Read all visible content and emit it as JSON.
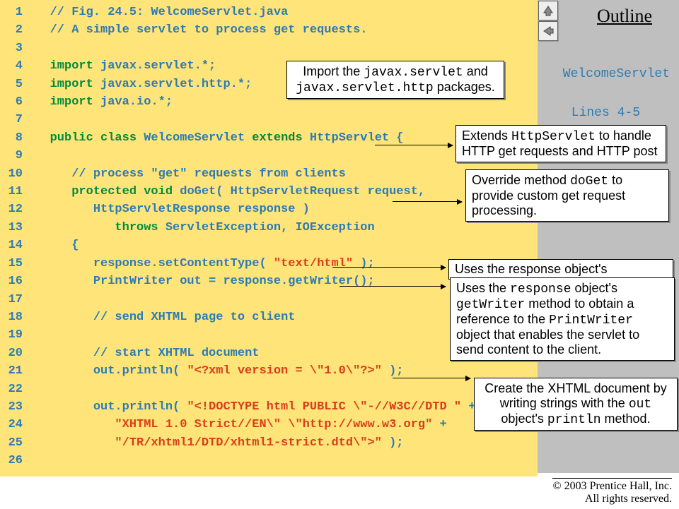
{
  "outline": "Outline",
  "side": {
    "name": "WelcomeServlet",
    "lines": "Lines 4-5"
  },
  "code": [
    {
      "n": "1",
      "segs": [
        {
          "t": "   ",
          "c": "co"
        },
        {
          "t": "// Fig. 24.5: WelcomeServlet.java",
          "c": "co"
        }
      ]
    },
    {
      "n": "2",
      "segs": [
        {
          "t": "   ",
          "c": "co"
        },
        {
          "t": "// A simple servlet to process get requests.",
          "c": "co"
        }
      ]
    },
    {
      "n": "3",
      "segs": [
        {
          "t": "",
          "c": "co"
        }
      ]
    },
    {
      "n": "4",
      "segs": [
        {
          "t": "   ",
          "c": "co"
        },
        {
          "t": "import",
          "c": "kw"
        },
        {
          "t": " javax.servlet.*;",
          "c": "tok"
        }
      ]
    },
    {
      "n": "5",
      "segs": [
        {
          "t": "   ",
          "c": "co"
        },
        {
          "t": "import",
          "c": "kw"
        },
        {
          "t": " javax.servlet.http.*;",
          "c": "tok"
        }
      ]
    },
    {
      "n": "6",
      "segs": [
        {
          "t": "   ",
          "c": "co"
        },
        {
          "t": "import",
          "c": "kw"
        },
        {
          "t": " java.io.*;",
          "c": "tok"
        }
      ]
    },
    {
      "n": "7",
      "segs": [
        {
          "t": "",
          "c": "co"
        }
      ]
    },
    {
      "n": "8",
      "segs": [
        {
          "t": "   ",
          "c": "co"
        },
        {
          "t": "public class",
          "c": "kw"
        },
        {
          "t": " WelcomeServlet ",
          "c": "tok"
        },
        {
          "t": "extends",
          "c": "kw"
        },
        {
          "t": " HttpServlet {",
          "c": "tok"
        }
      ]
    },
    {
      "n": "9",
      "segs": [
        {
          "t": "",
          "c": "co"
        }
      ]
    },
    {
      "n": "10",
      "segs": [
        {
          "t": "      ",
          "c": "co"
        },
        {
          "t": "// process \"get\" requests from clients",
          "c": "co"
        }
      ]
    },
    {
      "n": "11",
      "segs": [
        {
          "t": "      ",
          "c": "co"
        },
        {
          "t": "protected void",
          "c": "kw"
        },
        {
          "t": " doGet( HttpServletRequest request,",
          "c": "tok"
        }
      ]
    },
    {
      "n": "12",
      "segs": [
        {
          "t": "         HttpServletResponse response )",
          "c": "tok"
        }
      ]
    },
    {
      "n": "13",
      "segs": [
        {
          "t": "            ",
          "c": "co"
        },
        {
          "t": "throws",
          "c": "kw"
        },
        {
          "t": " ServletException, IOException",
          "c": "tok"
        }
      ]
    },
    {
      "n": "14",
      "segs": [
        {
          "t": "      {",
          "c": "tok"
        }
      ]
    },
    {
      "n": "15",
      "segs": [
        {
          "t": "         response.setContentType( ",
          "c": "tok"
        },
        {
          "t": "\"text/html\"",
          "c": "str"
        },
        {
          "t": " );",
          "c": "tok"
        }
      ]
    },
    {
      "n": "16",
      "segs": [
        {
          "t": "         PrintWriter out = response.getWriter();",
          "c": "tok"
        }
      ]
    },
    {
      "n": "17",
      "segs": [
        {
          "t": "",
          "c": "co"
        }
      ]
    },
    {
      "n": "18",
      "segs": [
        {
          "t": "         ",
          "c": "co"
        },
        {
          "t": "// send XHTML page to client",
          "c": "co"
        }
      ]
    },
    {
      "n": "19",
      "segs": [
        {
          "t": "",
          "c": "co"
        }
      ]
    },
    {
      "n": "20",
      "segs": [
        {
          "t": "         ",
          "c": "co"
        },
        {
          "t": "// start XHTML document",
          "c": "co"
        }
      ]
    },
    {
      "n": "21",
      "segs": [
        {
          "t": "         out.println( ",
          "c": "tok"
        },
        {
          "t": "\"<?xml version = \\\"1.0\\\"?>\"",
          "c": "str"
        },
        {
          "t": " );",
          "c": "tok"
        }
      ]
    },
    {
      "n": "22",
      "segs": [
        {
          "t": "",
          "c": "co"
        }
      ]
    },
    {
      "n": "23",
      "segs": [
        {
          "t": "         out.println( ",
          "c": "tok"
        },
        {
          "t": "\"<!DOCTYPE html PUBLIC \\\"-//W3C//DTD \"",
          "c": "str"
        },
        {
          "t": " +",
          "c": "tok"
        }
      ]
    },
    {
      "n": "24",
      "segs": [
        {
          "t": "            ",
          "c": "co"
        },
        {
          "t": "\"XHTML 1.0 Strict//EN\\\" \\\"http://www.w3.org\"",
          "c": "str"
        },
        {
          "t": " +",
          "c": "tok"
        }
      ]
    },
    {
      "n": "25",
      "segs": [
        {
          "t": "            ",
          "c": "co"
        },
        {
          "t": "\"/TR/xhtml1/DTD/xhtml1-strict.dtd\\\">\"",
          "c": "str"
        },
        {
          "t": " );",
          "c": "tok"
        }
      ]
    },
    {
      "n": "26",
      "segs": [
        {
          "t": "",
          "c": "co"
        }
      ]
    }
  ],
  "callouts": {
    "import_pre": "Import the ",
    "import_mono1": "javax.servlet",
    "import_mid": " and ",
    "import_mono2": "javax.servlet.http",
    "import_post": " packages.",
    "extends_pre": "Extends ",
    "extends_mono": "HttpServlet",
    "extends_rest": " to handle HTTP get requests and HTTP post",
    "override_pre": "Override method ",
    "override_mono": "doGet",
    "override_rest": " to provide custom get request processing.",
    "uses1": "Uses the response object's",
    "uses2_l1_pre": "Uses the ",
    "uses2_l1_mono": "response",
    "uses2_l1_post": " object's ",
    "uses2_l2_mono": "getWriter",
    "uses2_l2_post": " method to obtain a reference to the ",
    "uses2_l2_mono2": "PrintWriter",
    "uses2_l3": " object that enables the servlet to send content to the client.",
    "create_l1": "Create the XHTML document by writing strings with the ",
    "create_mono": "out",
    "create_l2": " object's ",
    "create_mono2": "println",
    "create_l3": " method."
  },
  "footer": {
    "line1": "© 2003 Prentice Hall, Inc.",
    "line2": "All rights reserved."
  }
}
